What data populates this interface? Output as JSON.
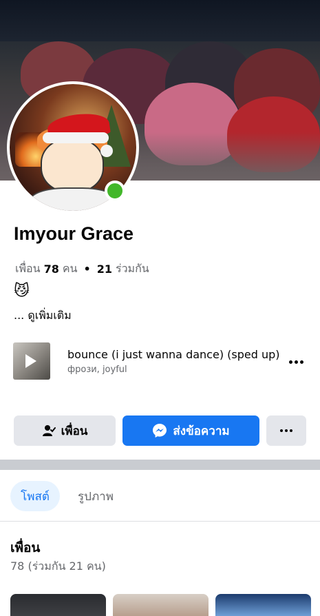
{
  "profile": {
    "name": "Imyour Grace",
    "friends_prefix": "เพื่อน",
    "friends_count": "78",
    "friends_unit": "คน",
    "mutual_count": "21",
    "mutual_label": "ร่วมกัน",
    "emoji": "😼",
    "see_more": "... ดูเพิ่มเติม"
  },
  "music": {
    "title": "bounce (i just wanna dance) (sped up)",
    "artist": "фрози, joyful"
  },
  "actions": {
    "friend_label": "เพื่อน",
    "message_label": "ส่งข้อความ"
  },
  "tabs": [
    {
      "label": "โพสต์",
      "active": true
    },
    {
      "label": "รูปภาพ",
      "active": false
    }
  ],
  "friends_section": {
    "title": "เพื่อน",
    "subtitle": "78 (ร่วมกัน 21 คน)"
  },
  "colors": {
    "accent": "#1877f2",
    "online": "#42b72a",
    "button_gray": "#e4e6eb",
    "secondary_text": "#65676b"
  },
  "icons": {
    "online": "online-status-dot",
    "friend": "person-check-icon",
    "message": "messenger-icon",
    "more": "more-horizontal-icon",
    "play": "play-icon"
  }
}
